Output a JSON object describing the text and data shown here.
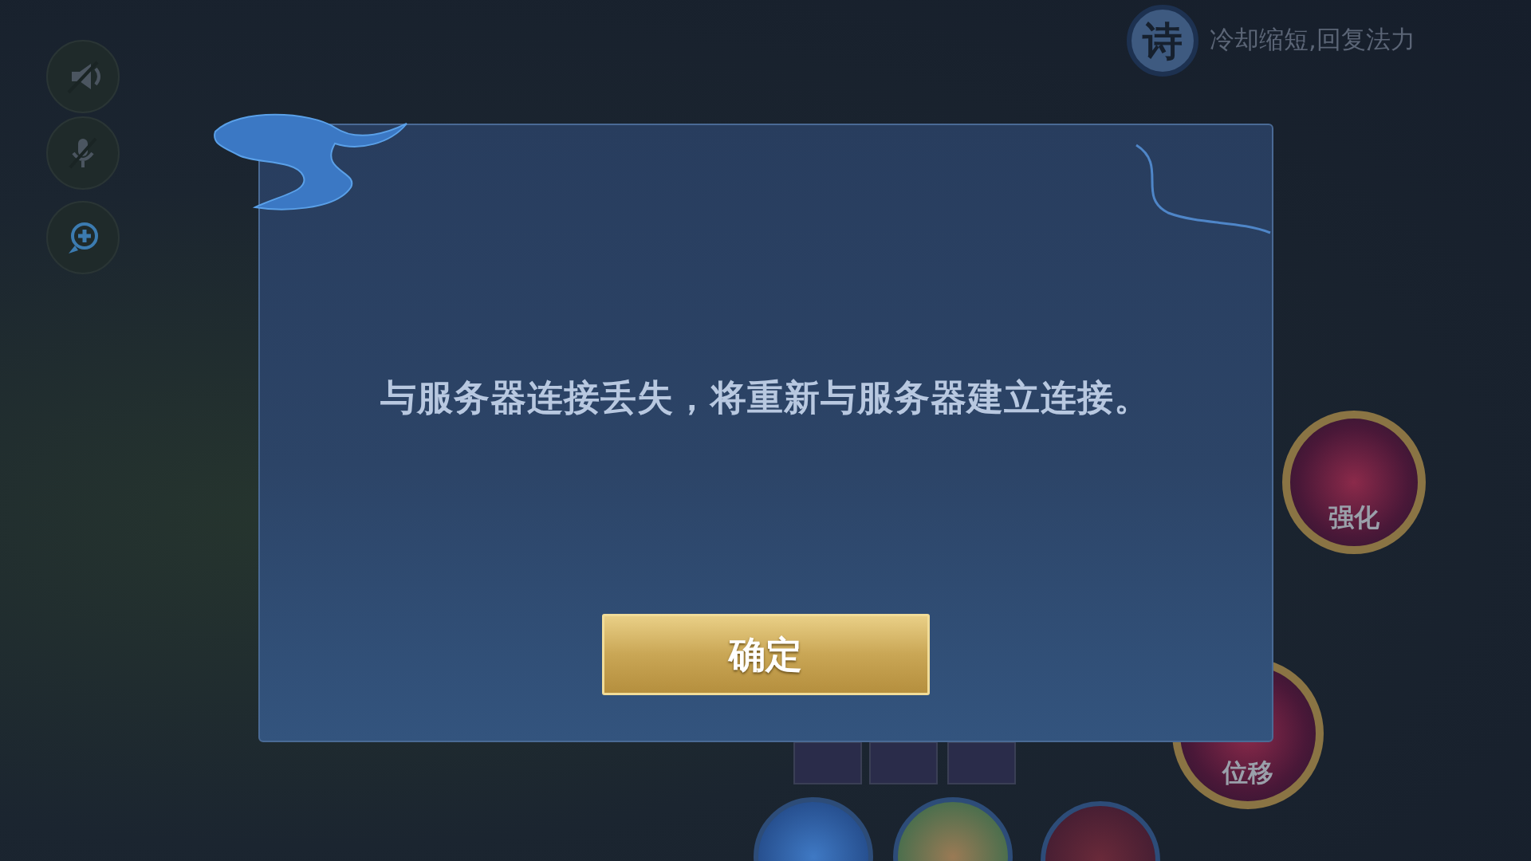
{
  "hud": {
    "hint": {
      "badge": "诗",
      "text": "冷却缩短,回复法力"
    },
    "left_buttons": [
      {
        "kind": "speaker"
      },
      {
        "kind": "mic"
      },
      {
        "kind": "add"
      }
    ],
    "skills": [
      {
        "label": "强化"
      },
      {
        "label": "位移"
      }
    ]
  },
  "dialog": {
    "message": "与服务器连接丢失，将重新与服务器建立连接。",
    "confirm_button": "确定"
  }
}
